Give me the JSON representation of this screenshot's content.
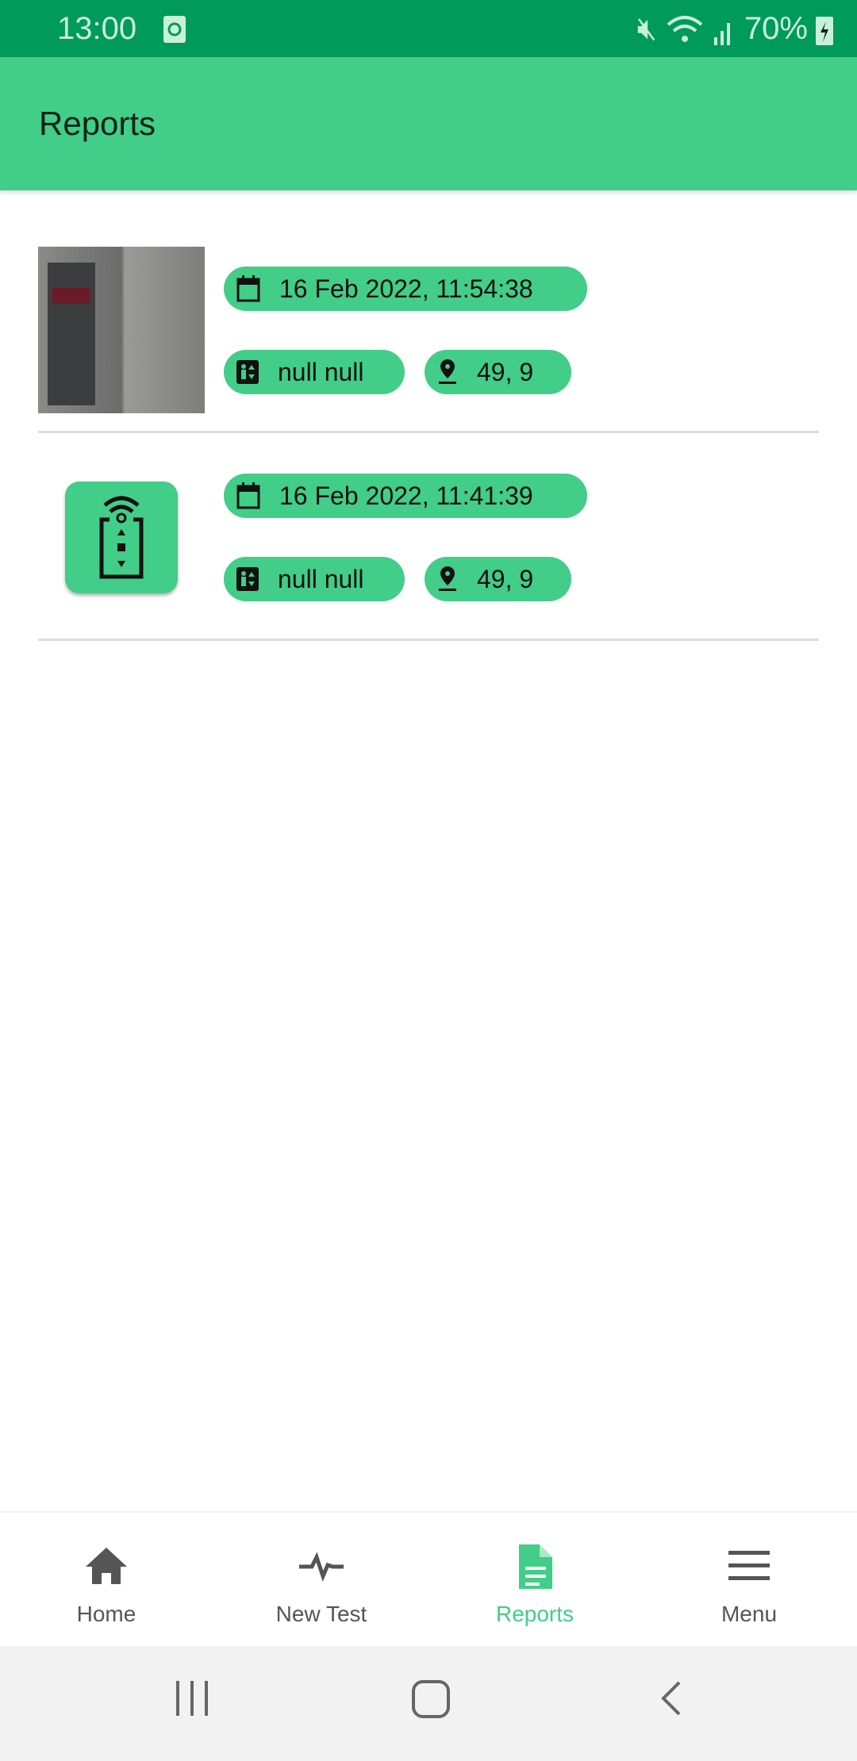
{
  "status_bar": {
    "time": "13:00",
    "battery": "70%"
  },
  "app_bar": {
    "title": "Reports"
  },
  "reports": [
    {
      "thumbnail": "elevator-photo",
      "date": "16 Feb 2022, 11:54:38",
      "lift": "null null",
      "location": "49, 9"
    },
    {
      "thumbnail": "app-lift-icon",
      "date": "16 Feb 2022, 11:41:39",
      "lift": "null null",
      "location": "49, 9"
    }
  ],
  "bottom_nav": {
    "items": [
      {
        "label": "Home",
        "icon": "home-icon"
      },
      {
        "label": "New Test",
        "icon": "pulse-icon"
      },
      {
        "label": "Reports",
        "icon": "document-icon",
        "active": true
      },
      {
        "label": "Menu",
        "icon": "menu-icon"
      }
    ]
  },
  "colors": {
    "status": "#009A5A",
    "primary": "#42CD88"
  }
}
